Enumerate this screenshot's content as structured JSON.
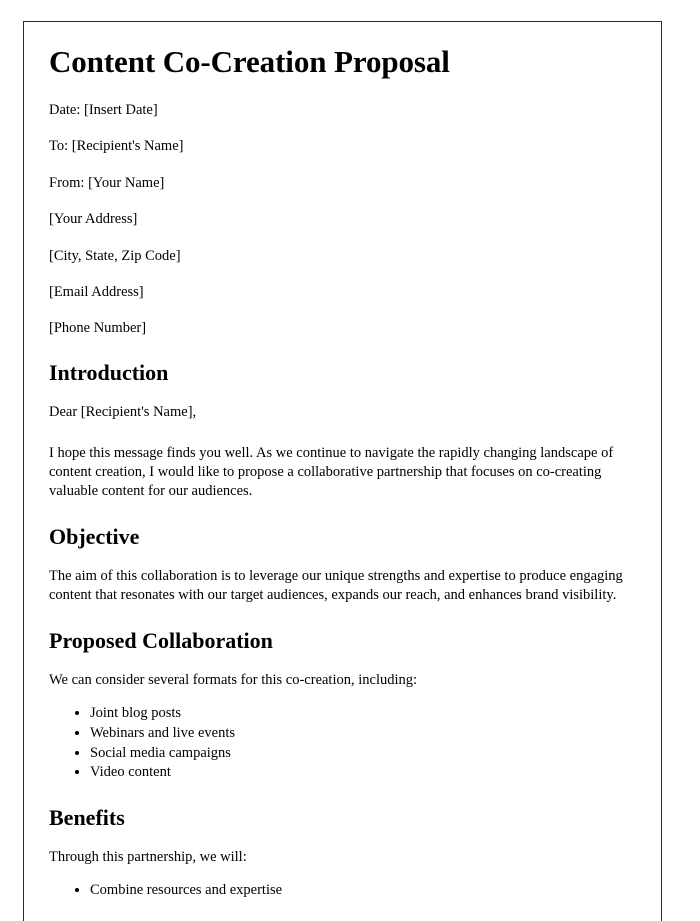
{
  "document": {
    "title": "Content Co-Creation Proposal",
    "meta": [
      "Date: [Insert Date]",
      "To: [Recipient's Name]",
      "From: [Your Name]",
      "[Your Address]",
      "[City, State, Zip Code]",
      "[Email Address]",
      "[Phone Number]"
    ],
    "sections": [
      {
        "heading": "Introduction",
        "salutation": "Dear [Recipient's Name],",
        "paragraph": "I hope this message finds you well. As we continue to navigate the rapidly changing landscape of content creation, I would like to propose a collaborative partnership that focuses on co-creating valuable content for our audiences."
      },
      {
        "heading": "Objective",
        "paragraph": "The aim of this collaboration is to leverage our unique strengths and expertise to produce engaging content that resonates with our target audiences, expands our reach, and enhances brand visibility."
      },
      {
        "heading": "Proposed Collaboration",
        "paragraph": "We can consider several formats for this co-creation, including:",
        "items": [
          "Joint blog posts",
          "Webinars and live events",
          "Social media campaigns",
          "Video content"
        ]
      },
      {
        "heading": "Benefits",
        "paragraph": "Through this partnership, we will:",
        "items": [
          "Combine resources and expertise"
        ]
      }
    ]
  }
}
